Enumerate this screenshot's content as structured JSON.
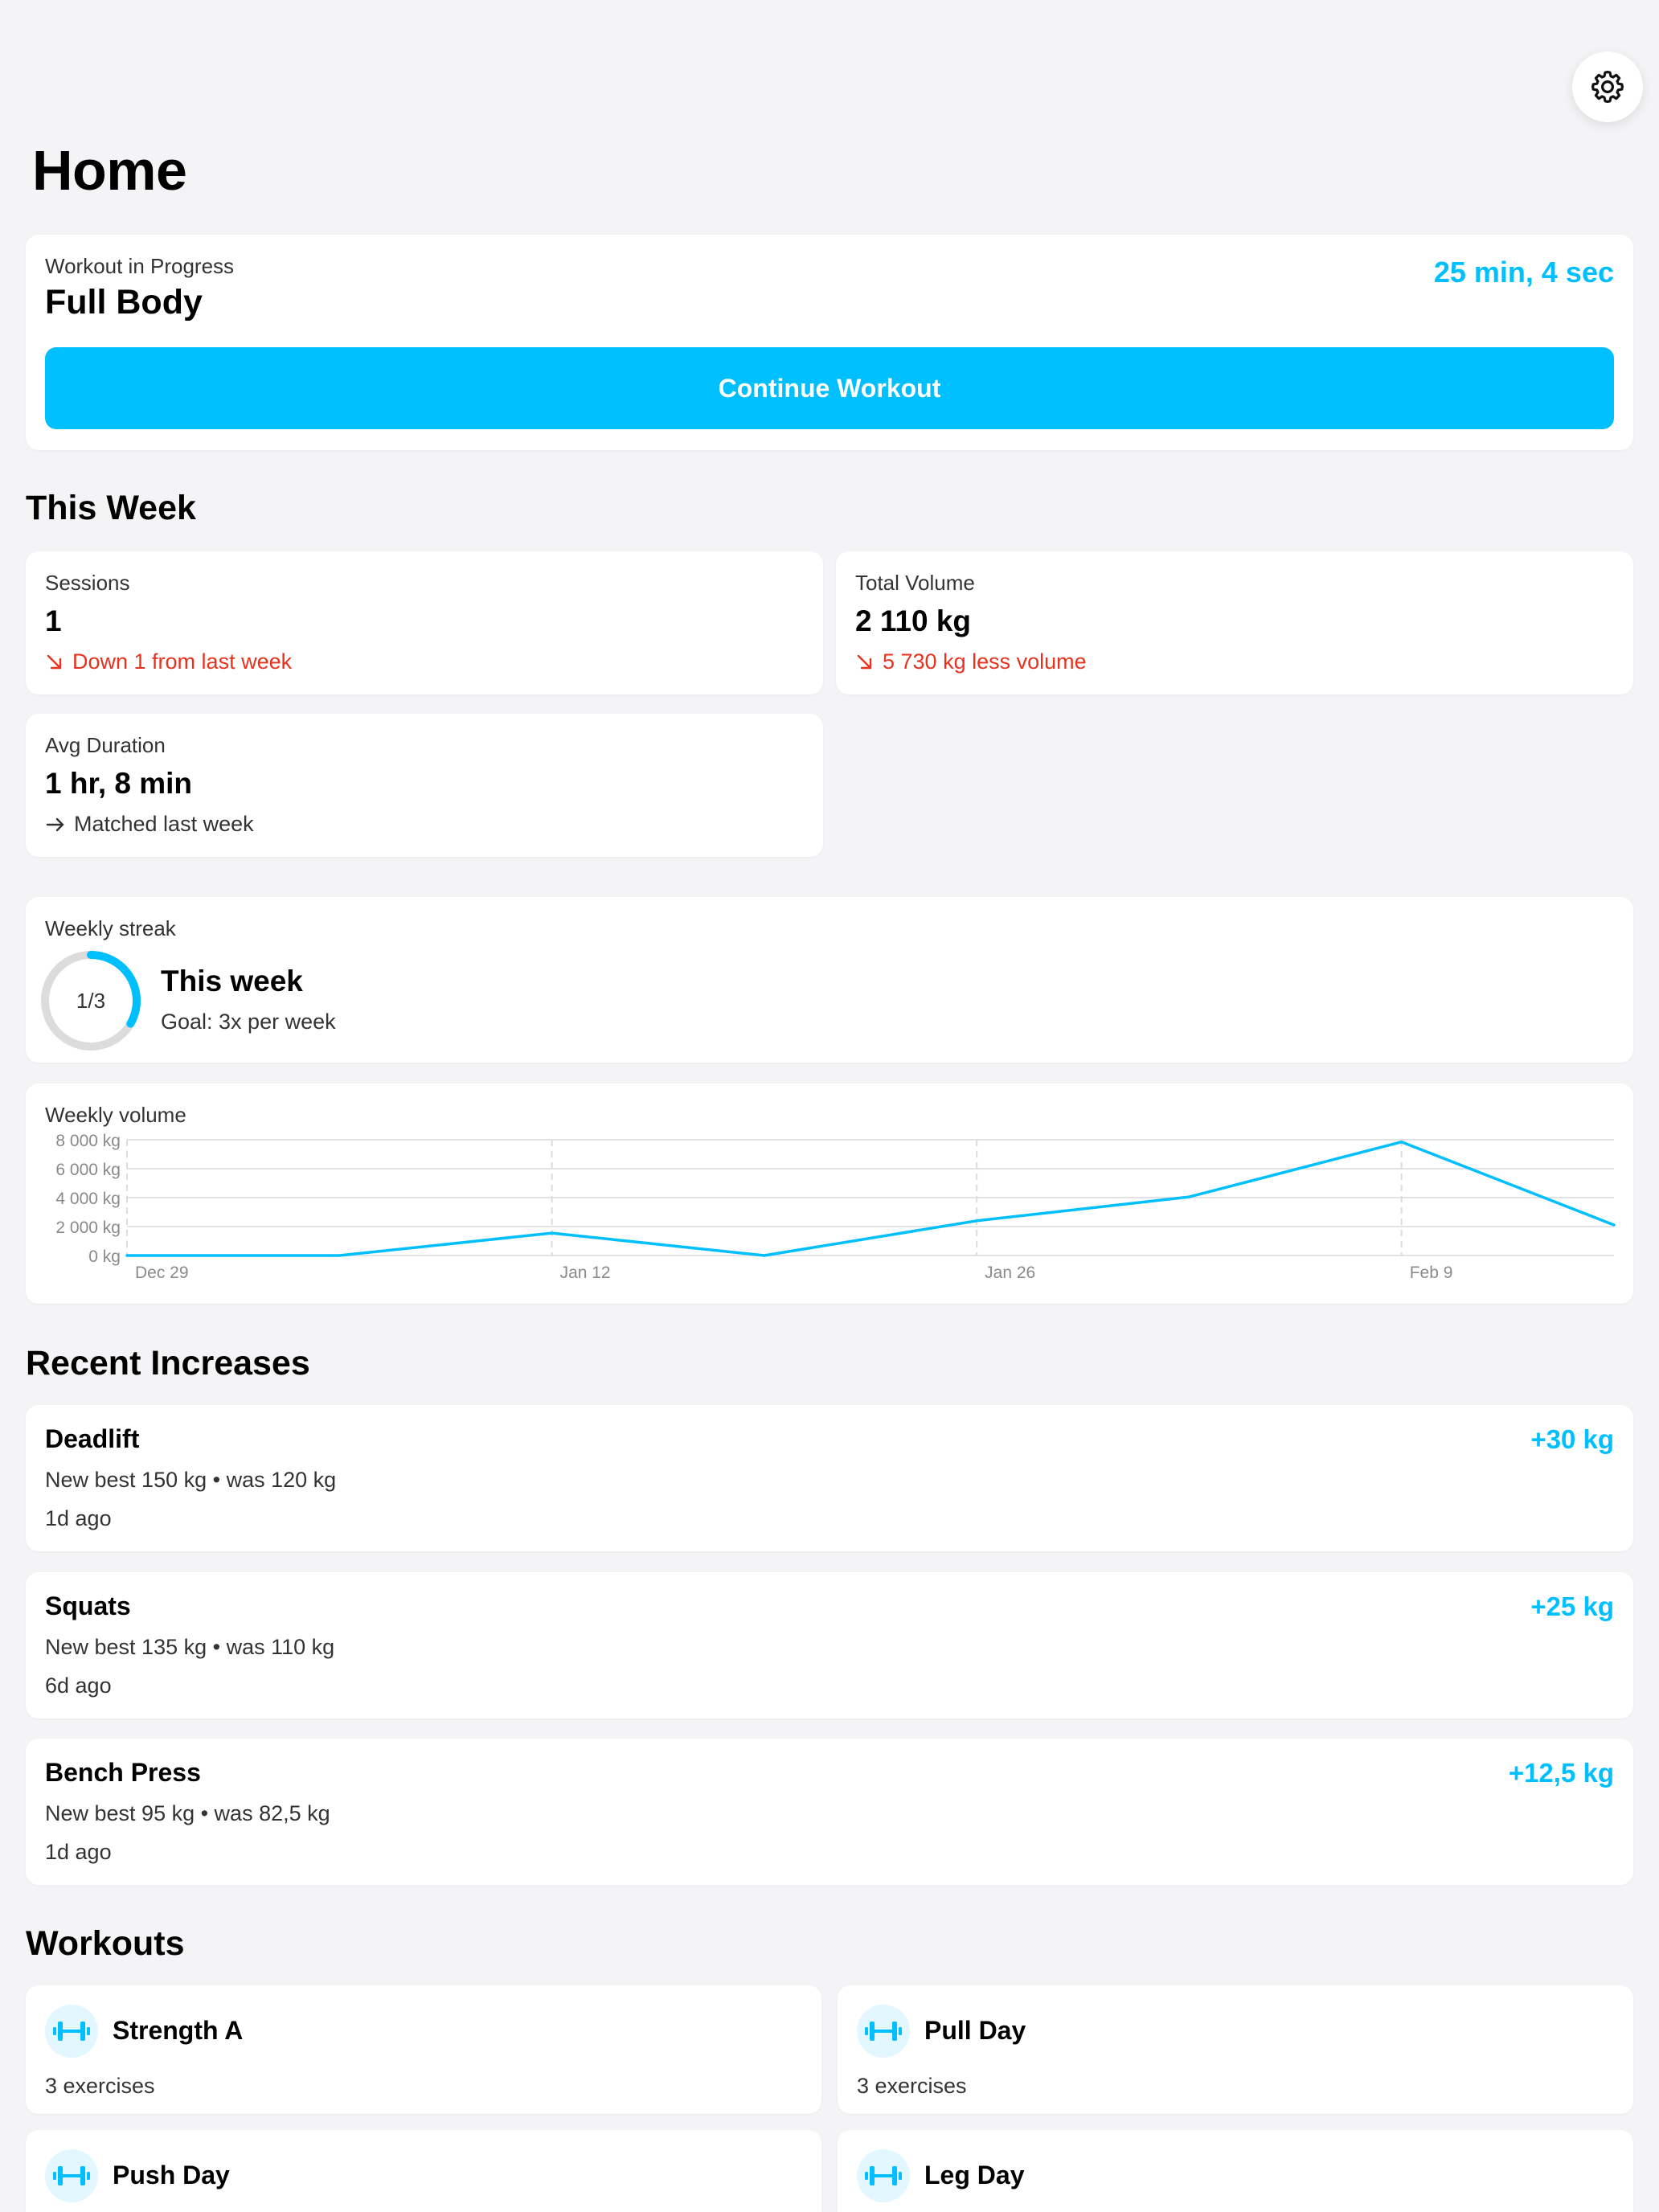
{
  "page": {
    "title": "Home"
  },
  "workout_in_progress": {
    "label": "Workout in Progress",
    "name": "Full Body",
    "timer": "25 min, 4 sec",
    "button_label": "Continue Workout"
  },
  "this_week": {
    "title": "This Week",
    "sessions": {
      "label": "Sessions",
      "value": "1",
      "delta": "Down 1 from last week",
      "trend": "down"
    },
    "volume": {
      "label": "Total Volume",
      "value": "2 110 kg",
      "delta": "5 730 kg less volume",
      "trend": "down"
    },
    "duration": {
      "label": "Avg Duration",
      "value": "1 hr, 8 min",
      "delta": "Matched last week",
      "trend": "flat"
    }
  },
  "streak": {
    "label": "Weekly streak",
    "ring_text": "1/3",
    "progress": 0.3333,
    "title": "This week",
    "goal": "Goal: 3x per week"
  },
  "chart_data": {
    "type": "line",
    "title": "Weekly volume",
    "xlabel": "",
    "ylabel": "",
    "ylim": [
      0,
      8000
    ],
    "y_ticks": [
      "0 kg",
      "2 000 kg",
      "4 000 kg",
      "6 000 kg",
      "8 000 kg"
    ],
    "y_tick_values": [
      0,
      2000,
      4000,
      6000,
      8000
    ],
    "x_tick_labels": [
      "Dec 29",
      "Jan 12",
      "Jan 26",
      "Feb 9"
    ],
    "x_tick_index": [
      0,
      2,
      4,
      6
    ],
    "x": [
      "Dec 29",
      "Jan 5",
      "Jan 12",
      "Jan 19",
      "Jan 26",
      "Feb 2",
      "Feb 9",
      "Feb 16"
    ],
    "series": [
      {
        "values": [
          0,
          0,
          1550,
          0,
          2400,
          4050,
          7850,
          2110
        ]
      }
    ],
    "grid": true,
    "color": "#00bfff"
  },
  "recent_increases": {
    "title": "Recent Increases",
    "items": [
      {
        "name": "Deadlift",
        "delta": "+30 kg",
        "detail": "New best 150 kg • was 120 kg",
        "time": "1d ago"
      },
      {
        "name": "Squats",
        "delta": "+25 kg",
        "detail": "New best 135 kg • was 110 kg",
        "time": "6d ago"
      },
      {
        "name": "Bench Press",
        "delta": "+12,5 kg",
        "detail": "New best 95 kg • was 82,5 kg",
        "time": "1d ago"
      }
    ]
  },
  "workouts": {
    "title": "Workouts",
    "items": [
      {
        "name": "Strength A",
        "count": "3 exercises",
        "icon": "dumbbell-icon"
      },
      {
        "name": "Pull Day",
        "count": "3 exercises",
        "icon": "dumbbell-icon"
      },
      {
        "name": "Push Day",
        "count": "",
        "icon": "dumbbell-icon"
      },
      {
        "name": "Leg Day",
        "count": "",
        "icon": "dumbbell-icon"
      }
    ]
  },
  "colors": {
    "accent": "#00bfff",
    "negative": "#e8321e",
    "background": "#f4f4f6",
    "card": "#ffffff"
  }
}
